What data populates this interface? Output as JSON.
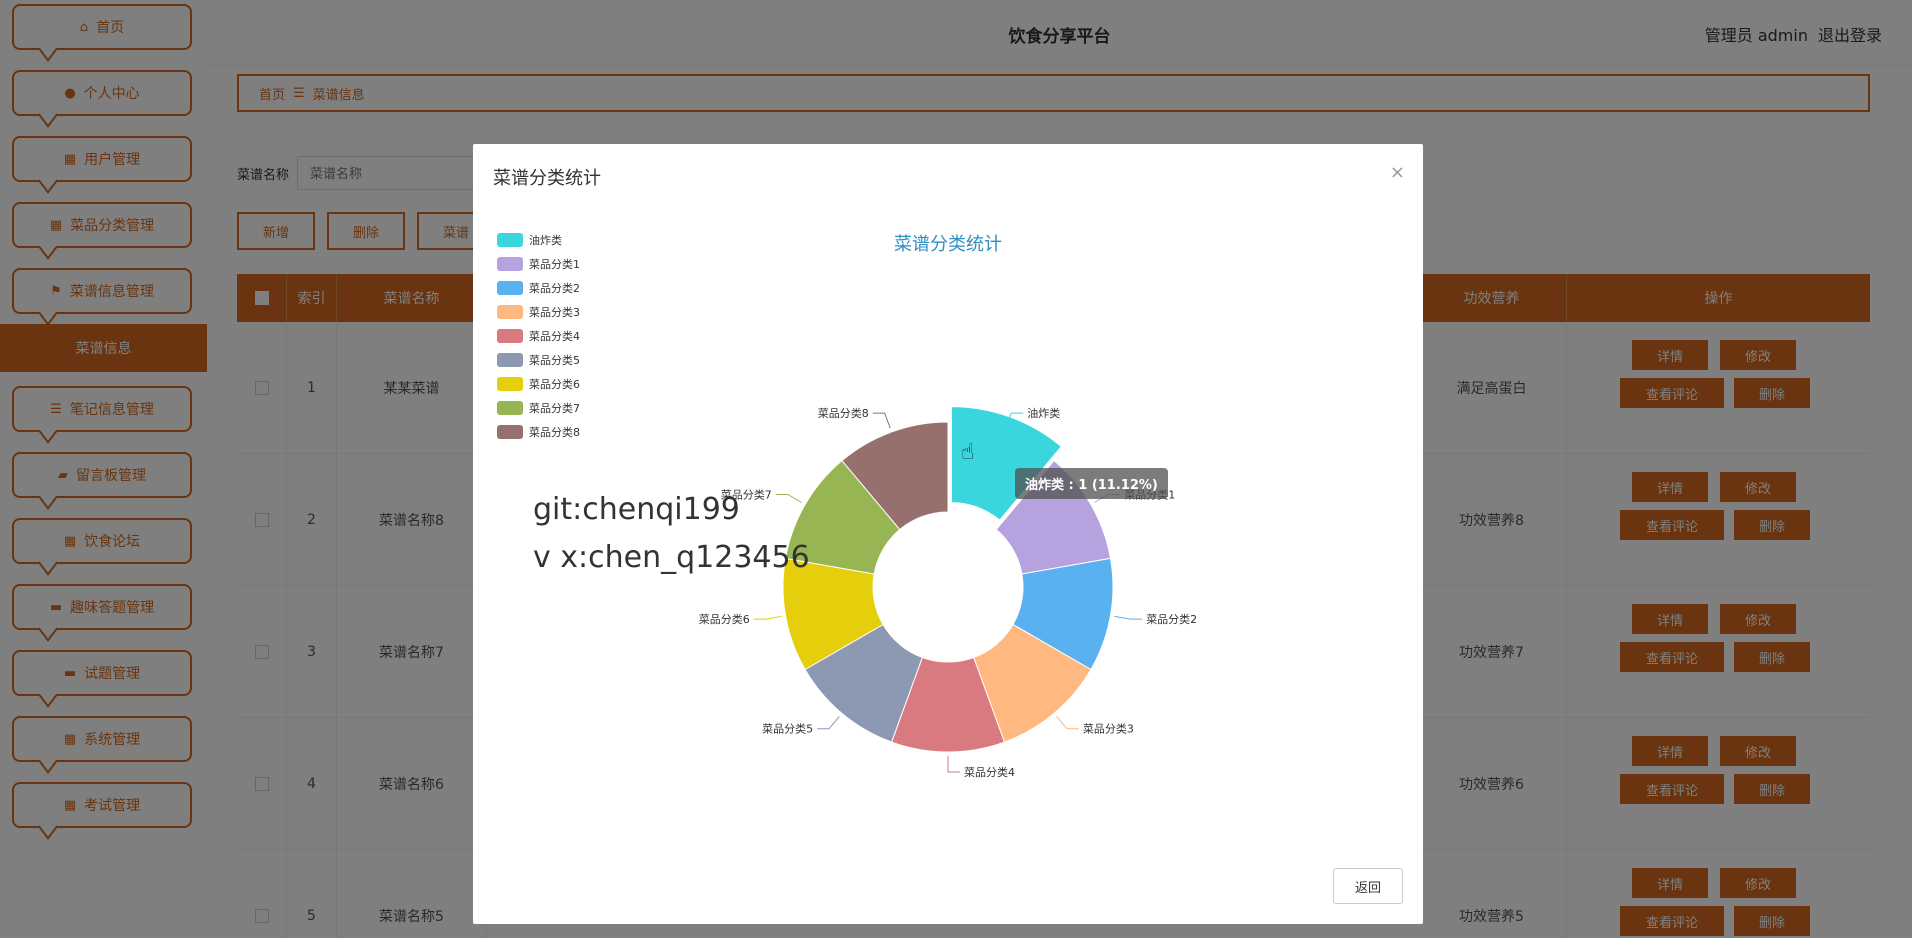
{
  "app": {
    "title": "饮食分享平台",
    "admin_label": "管理员 admin",
    "logout_label": "退出登录"
  },
  "sidebar": {
    "items": [
      {
        "label": "首页",
        "icon": "home-icon"
      },
      {
        "label": "个人中心",
        "icon": "user-icon"
      },
      {
        "label": "用户管理",
        "icon": "grid-icon"
      },
      {
        "label": "菜品分类管理",
        "icon": "grid-icon"
      },
      {
        "label": "菜谱信息管理",
        "icon": "flag-icon"
      },
      {
        "label": "笔记信息管理",
        "icon": "list-icon"
      },
      {
        "label": "留言板管理",
        "icon": "thumb-icon"
      },
      {
        "label": "饮食论坛",
        "icon": "grid-icon"
      },
      {
        "label": "趣味答题管理",
        "icon": "monitor-icon"
      },
      {
        "label": "试题管理",
        "icon": "monitor-icon"
      },
      {
        "label": "系统管理",
        "icon": "grid-icon"
      },
      {
        "label": "考试管理",
        "icon": "grid-icon"
      }
    ],
    "active_sub": "菜谱信息"
  },
  "breadcrumb": {
    "home": "首页",
    "sep": "☰",
    "current": "菜谱信息"
  },
  "search": {
    "label": "菜谱名称",
    "placeholder": "菜谱名称"
  },
  "buttons": {
    "add": "新增",
    "delete": "删除",
    "stats": "菜谱"
  },
  "table": {
    "headers": {
      "index": "索引",
      "name": "菜谱名称",
      "effect": "功效营养",
      "ops": "操作"
    },
    "rows": [
      {
        "index": "1",
        "name": "某某菜谱",
        "effect": "满足高蛋白"
      },
      {
        "index": "2",
        "name": "菜谱名称8",
        "effect": "功效营养8"
      },
      {
        "index": "3",
        "name": "菜谱名称7",
        "effect": "功效营养7"
      },
      {
        "index": "4",
        "name": "菜谱名称6",
        "effect": "功效营养6"
      },
      {
        "index": "5",
        "name": "菜谱名称5",
        "effect": "功效营养5"
      }
    ],
    "actions": {
      "detail": "详情",
      "edit": "修改",
      "comments": "查看评论",
      "remove": "删除"
    }
  },
  "modal": {
    "title": "菜谱分类统计",
    "close_glyph": "×",
    "back_label": "返回",
    "tooltip": "油炸类 : 1 (11.12%)",
    "watermark_line1": "git:chenqi199",
    "watermark_line2": "v x:chen_q123456"
  },
  "chart_data": {
    "type": "pie",
    "title": "菜谱分类统计",
    "donut": true,
    "legend_position": "top-left",
    "categories": [
      "油炸类",
      "菜品分类1",
      "菜品分类2",
      "菜品分类3",
      "菜品分类4",
      "菜品分类5",
      "菜品分类6",
      "菜品分类7",
      "菜品分类8"
    ],
    "values": [
      1,
      1,
      1,
      1,
      1,
      1,
      1,
      1,
      1
    ],
    "colors": [
      "#3ad6dd",
      "#b6a2de",
      "#5ab1ef",
      "#ffb980",
      "#d87a80",
      "#8d98b3",
      "#e5cf0d",
      "#97b552",
      "#95706d"
    ],
    "highlighted": "油炸类"
  }
}
